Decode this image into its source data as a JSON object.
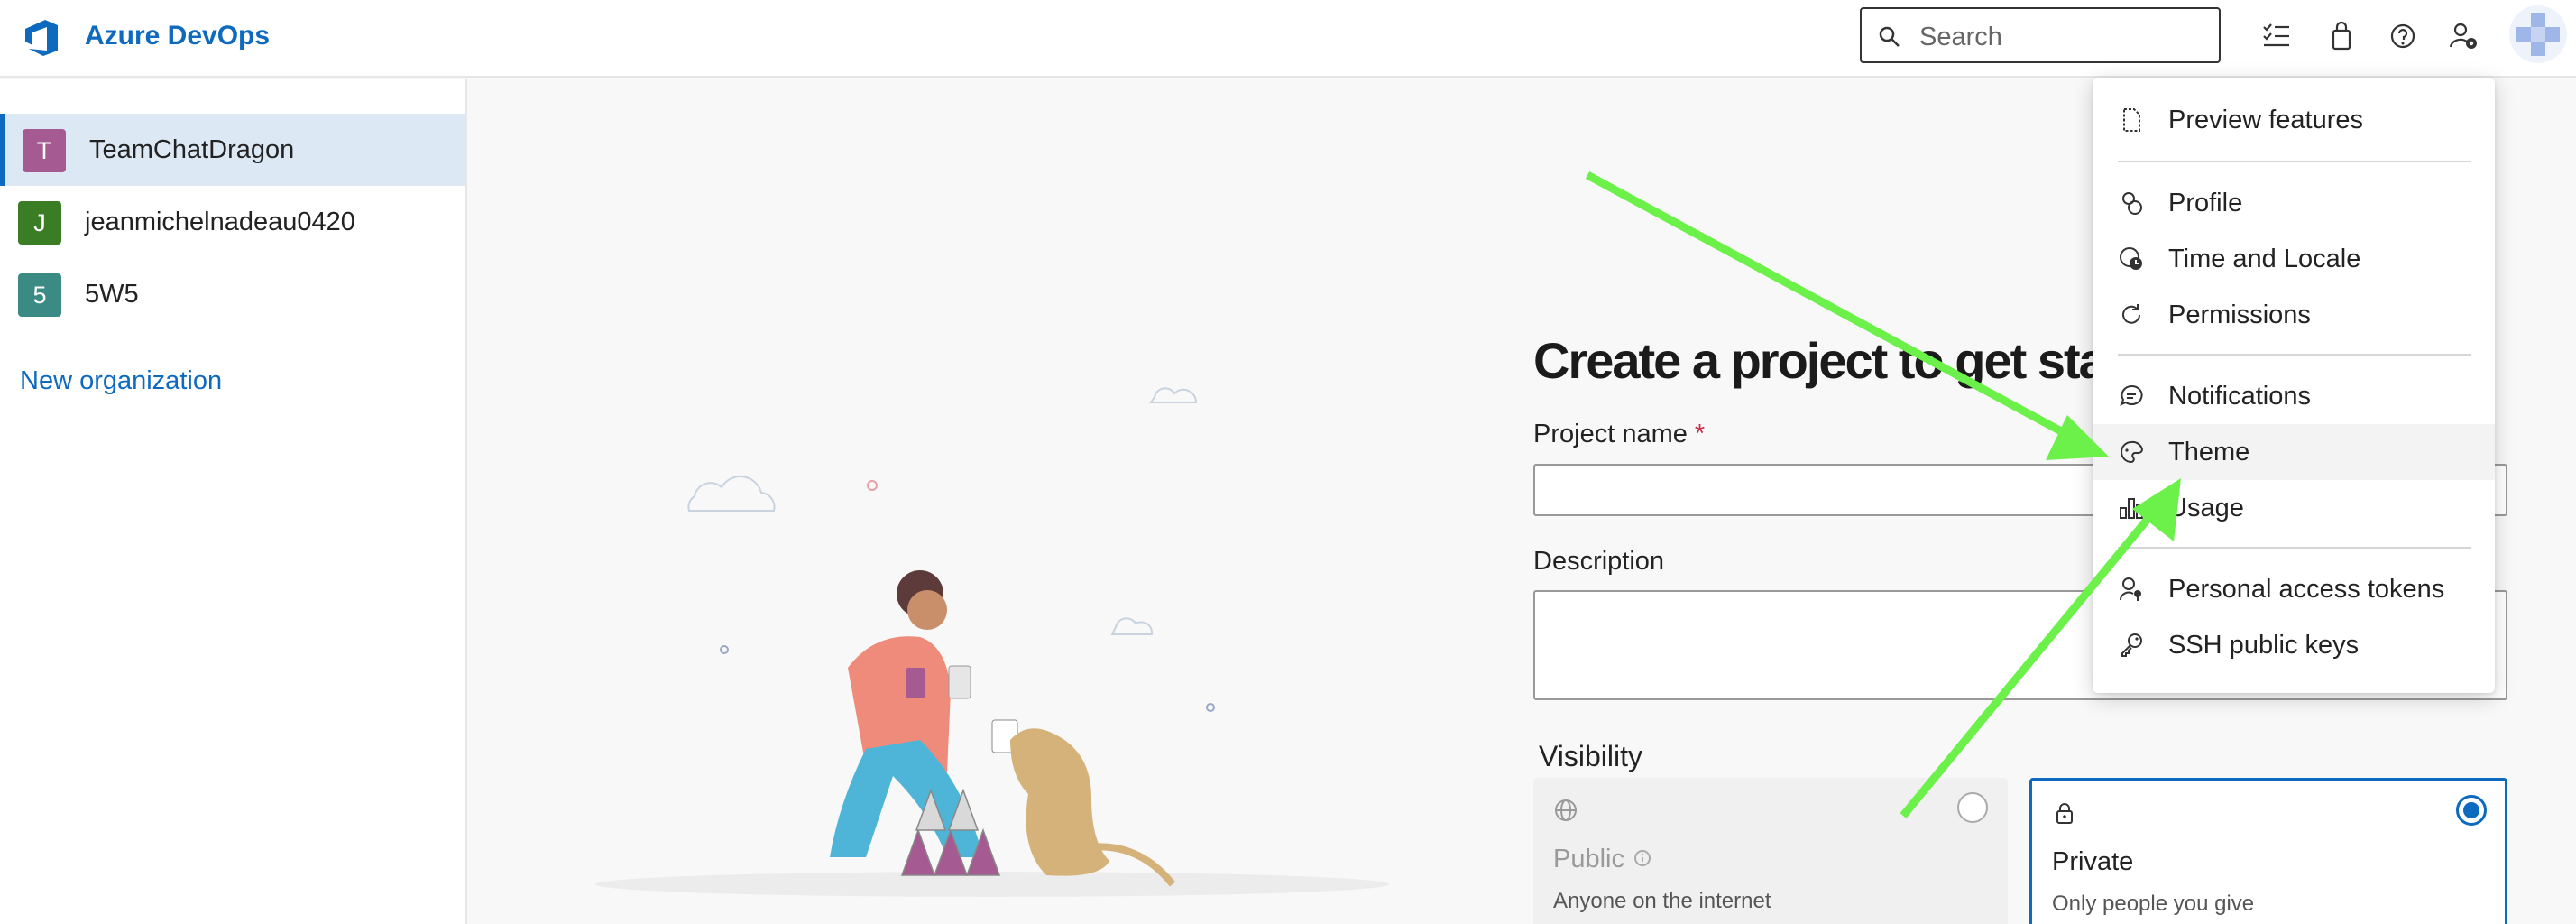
{
  "header": {
    "brand": "Azure DevOps",
    "search_placeholder": "Search",
    "icons": [
      "task-list-icon",
      "shopping-bag-icon",
      "help-icon",
      "user-settings-icon"
    ]
  },
  "sidebar": {
    "organizations": [
      {
        "initial": "T",
        "name": "TeamChatDragon",
        "color": "#a65a92",
        "selected": true
      },
      {
        "initial": "J",
        "name": "jeanmichelnadeau0420",
        "color": "#3a7d25",
        "selected": false
      },
      {
        "initial": "5",
        "name": "5W5",
        "color": "#3c8a84",
        "selected": false
      }
    ],
    "new_org": "New organization"
  },
  "main": {
    "heading": "Create a project to get started",
    "project_name_label": "Project name",
    "required_marker": "*",
    "description_label": "Description",
    "visibility_label": "Visibility",
    "public": {
      "title": "Public",
      "desc": "Anyone on the internet"
    },
    "private": {
      "title": "Private",
      "desc": "Only people you give"
    }
  },
  "menu": {
    "items": [
      {
        "label": "Preview features",
        "icon": "document-icon"
      },
      {
        "label": "Profile",
        "icon": "profile-icon"
      },
      {
        "label": "Time and Locale",
        "icon": "globe-clock-icon"
      },
      {
        "label": "Permissions",
        "icon": "refresh-icon"
      },
      {
        "label": "Notifications",
        "icon": "chat-icon"
      },
      {
        "label": "Theme",
        "icon": "palette-icon"
      },
      {
        "label": "Usage",
        "icon": "bar-chart-icon"
      },
      {
        "label": "Personal access tokens",
        "icon": "person-key-icon"
      },
      {
        "label": "SSH public keys",
        "icon": "key-icon"
      }
    ]
  },
  "colors": {
    "accent": "#0d6abf",
    "arrow": "#6cf04a",
    "selected_bg": "#dce9f5"
  }
}
